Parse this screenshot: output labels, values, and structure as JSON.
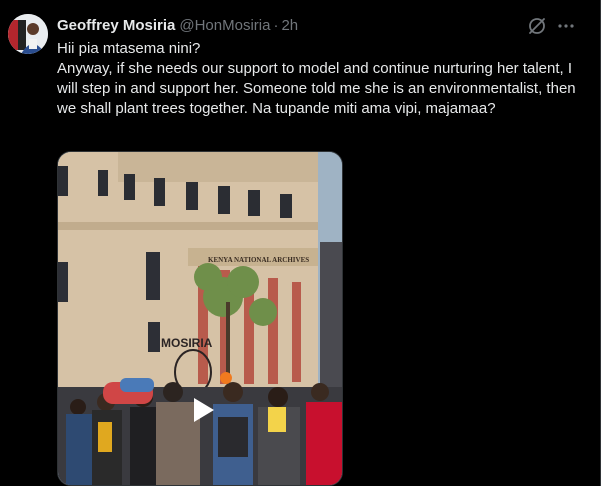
{
  "author": {
    "name": "Geoffrey Mosiria",
    "handle": "@HonMosiria",
    "separator": "·",
    "time": "2h"
  },
  "tweet": {
    "line1": "Hii pia mtasema nini?",
    "line2": "Anyway, if she needs our support to model and continue nurturing her talent, I will step in and support her. Someone told me she is an environmentalist, then we shall plant trees together. Na tupande miti ama vipi, majamaa?"
  },
  "media": {
    "building_sign": "KENYA NATIONAL ARCHIVES",
    "sculpture_text": "MOSIRIA"
  },
  "icons": {
    "grok": "grok-icon",
    "more": "more-icon",
    "play": "play-icon"
  },
  "colors": {
    "background": "#000000",
    "text": "#e7e9ea",
    "muted": "#71767b",
    "border": "#2f3336"
  }
}
